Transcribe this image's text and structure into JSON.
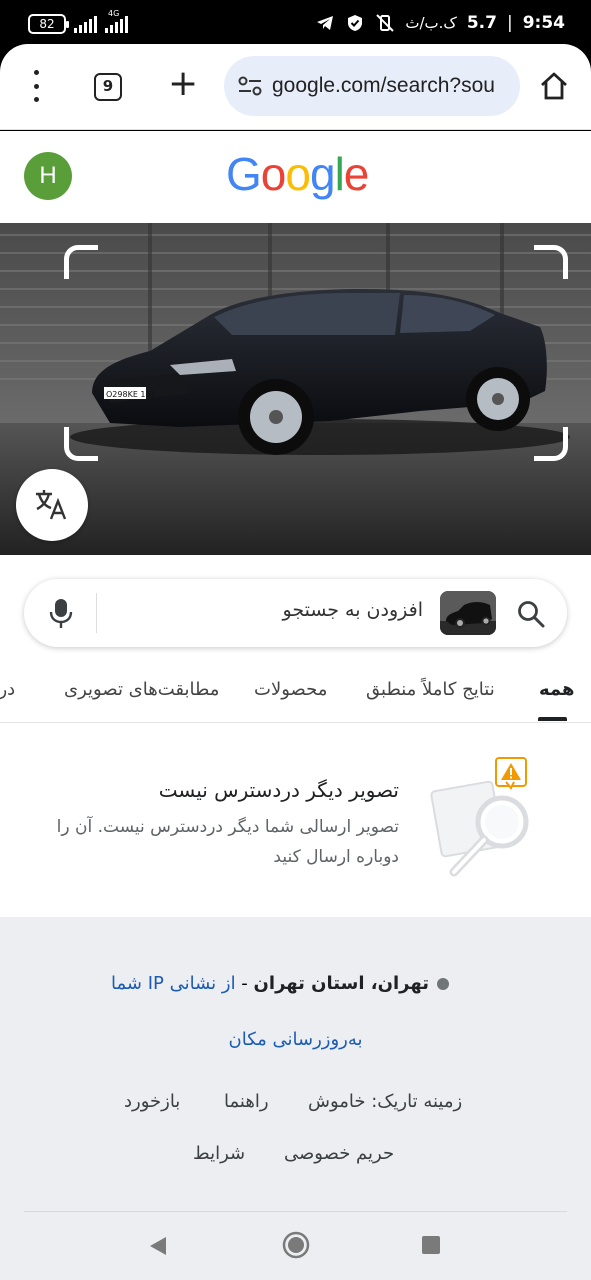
{
  "status_bar": {
    "battery": "82",
    "network_type": "4G",
    "speed": "5.7",
    "carrier_text": "ک.ب/ث",
    "time": "9:54"
  },
  "browser": {
    "tab_count": "9",
    "url": "google.com/search?sou"
  },
  "account": {
    "avatar_letter": "H",
    "avatar_color": "#5a9e3a"
  },
  "logo": {
    "letters": [
      "G",
      "o",
      "o",
      "g",
      "l",
      "e"
    ],
    "colors": [
      "#4285F4",
      "#EA4335",
      "#FBBC05",
      "#4285F4",
      "#34A853",
      "#EA4335"
    ]
  },
  "hero": {
    "plate_text": "O298KE 161"
  },
  "search": {
    "placeholder": "افزودن به جستجو"
  },
  "filter_tabs": [
    {
      "label": "همه",
      "active": true
    },
    {
      "label": "نتایج کاملاً منطبق"
    },
    {
      "label": "محصولات"
    },
    {
      "label": "مطابقت‌های تصویری"
    },
    {
      "label": "دربا"
    }
  ],
  "notice": {
    "title": "تصویر دیگر دردسترس نیست",
    "body": "تصویر ارسالی شما دیگر دردسترس نیست. آن را دوباره ارسال کنید"
  },
  "footer": {
    "city": "تهران، استان تهران",
    "separator": " - ",
    "ip_link": "از نشانی IP شما",
    "update_location": "به‌روزرسانی مکان",
    "dark_theme": "زمینه تاریک: خاموش",
    "help": "راهنما",
    "feedback": "بازخورد",
    "privacy": "حریم خصوصی",
    "terms": "شرایط"
  }
}
